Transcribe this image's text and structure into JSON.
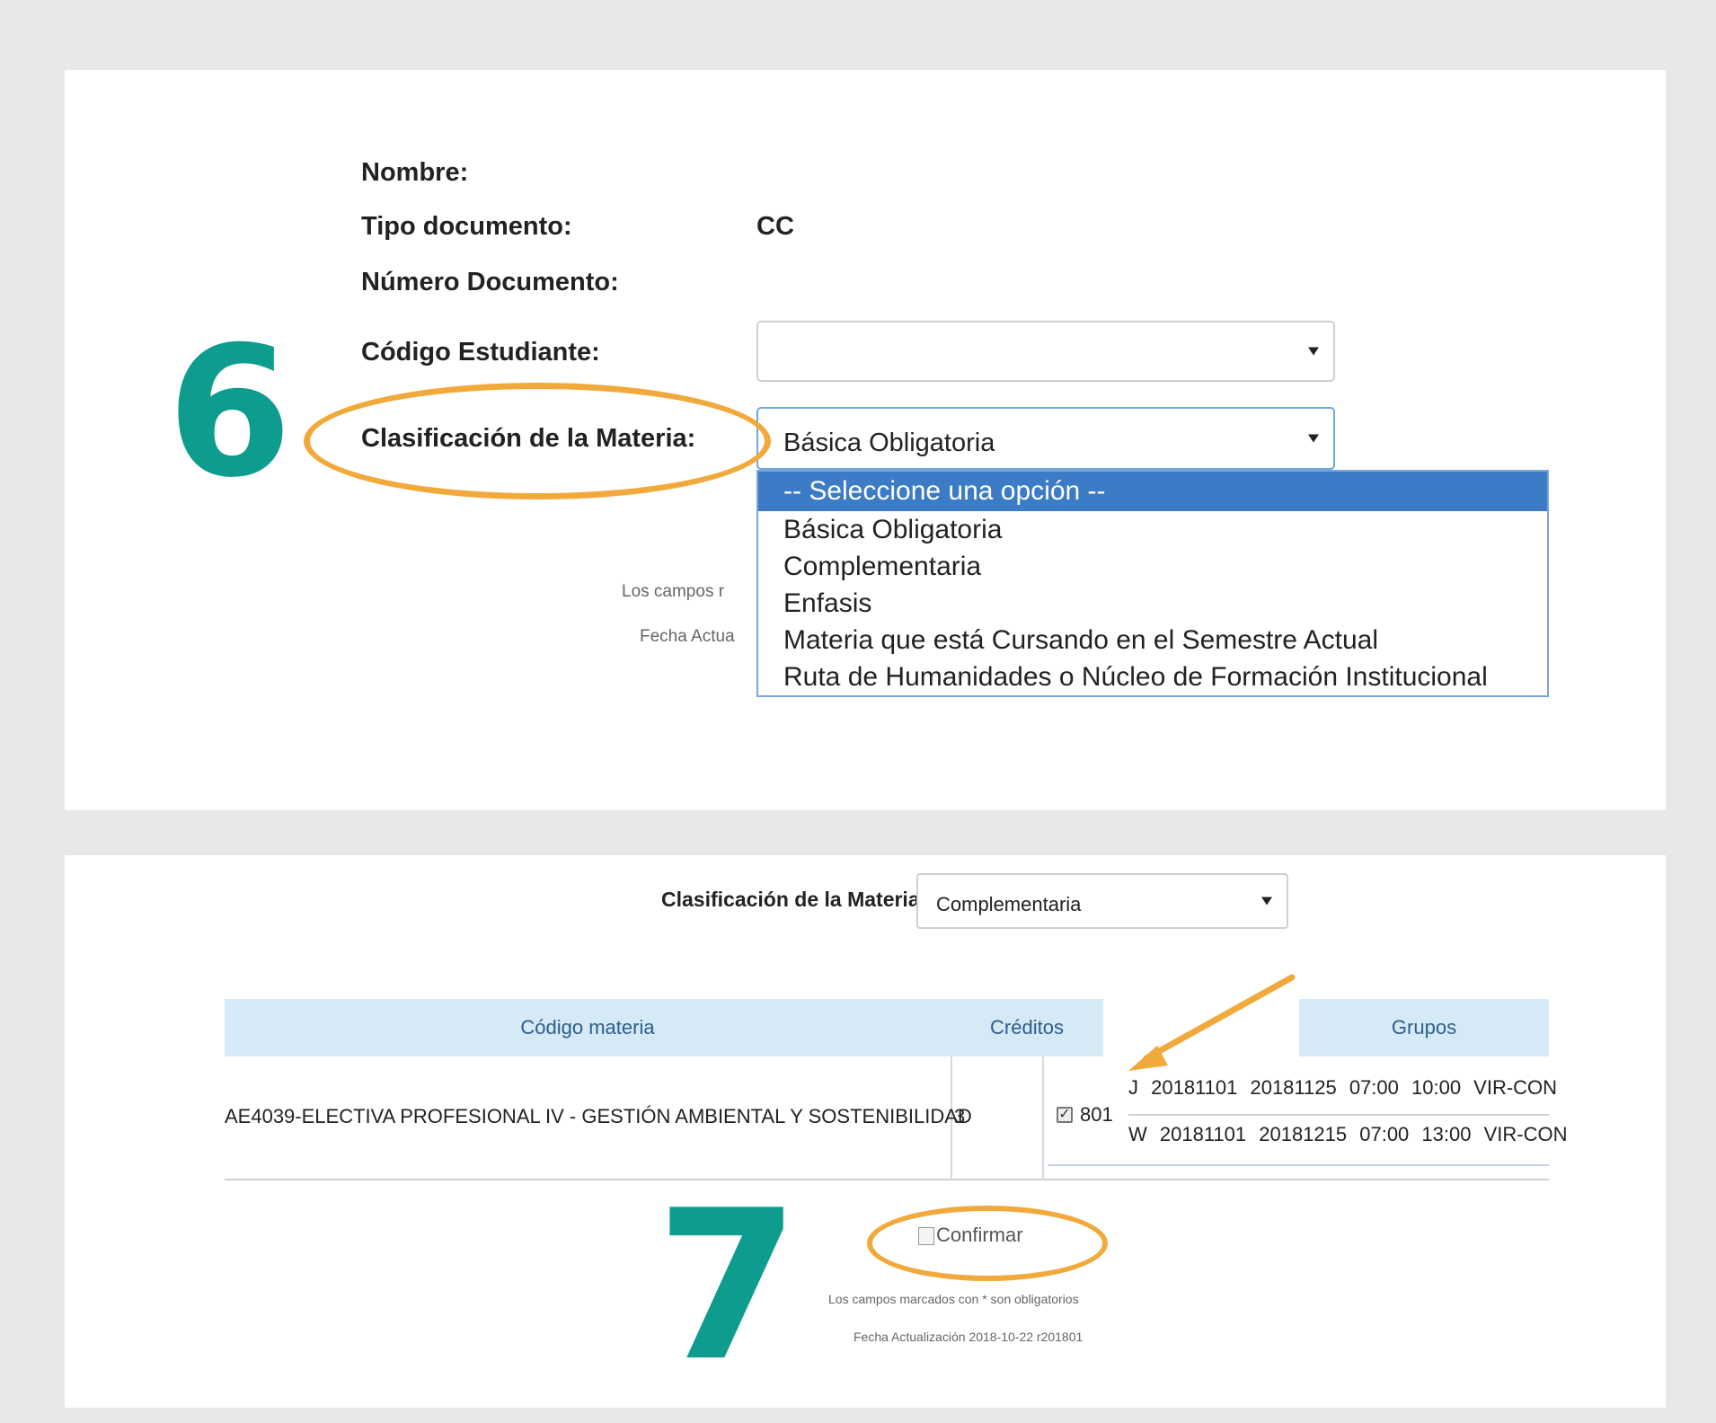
{
  "steps": {
    "first": "6",
    "second": "7"
  },
  "form": {
    "nombre_label": "Nombre:",
    "tipo_documento_label": "Tipo documento:",
    "tipo_documento_value": "CC",
    "numero_documento_label": "Número Documento:",
    "codigo_estudiante_label": "Código Estudiante:",
    "codigo_estudiante_value": "",
    "clasificacion_label": "Clasificación de la Materia:",
    "clasificacion_value": "Básica Obligatoria"
  },
  "dropdown": {
    "options": [
      "-- Seleccione una opción --",
      "Básica Obligatoria",
      "Complementaria",
      "Enfasis",
      "Materia que está Cursando en el Semestre Actual",
      "Ruta de Humanidades o Núcleo de Formación Institucional"
    ],
    "highlighted_index": 0
  },
  "obscured_footer": {
    "campos_partial": "Los campos r",
    "fecha_partial": "Fecha Actua"
  },
  "second_screen": {
    "clasificacion_label": "Clasificación de la Materia:",
    "clasificacion_value": "Complementaria",
    "table": {
      "headers": {
        "codigo": "Código materia",
        "creditos": "Créditos",
        "grupos": "Grupos"
      },
      "row": {
        "codigo": "AE4039-ELECTIVA PROFESIONAL IV - GESTIÓN AMBIENTAL Y SOSTENIBILIDAD",
        "creditos": "3",
        "group_checked": true,
        "group_id": "801",
        "schedules": [
          "J 20181101 20181125 07:00 10:00 VIR-CON",
          "W 20181101 20181215 07:00 13:00 VIR-CON"
        ]
      }
    },
    "confirm_label": "Confirmar",
    "footer_required": "Los campos marcados con * son obligatorios",
    "footer_date": "Fecha Actualización 2018-10-22 r201801"
  },
  "colors": {
    "accent_teal": "#0e9c8f",
    "highlight_orange": "#f2a93b",
    "dropdown_selected": "#3c7bc6",
    "table_header": "#d6e9f7"
  }
}
